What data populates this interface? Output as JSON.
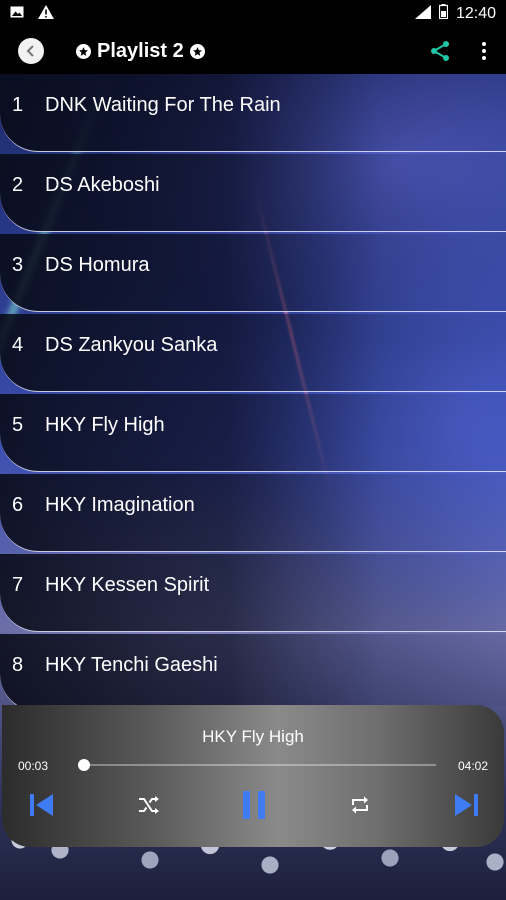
{
  "status_bar": {
    "time": "12:40",
    "icons": [
      "image-icon",
      "warning-icon",
      "wifi-icon",
      "battery-icon"
    ]
  },
  "app_bar": {
    "title": "Playlist 2",
    "icons": [
      "back-icon",
      "star-badge-icon",
      "share-icon",
      "more-vert-icon"
    ]
  },
  "tracks": [
    {
      "num": "1",
      "title": "DNK Waiting For The Rain"
    },
    {
      "num": "2",
      "title": "DS Akeboshi"
    },
    {
      "num": "3",
      "title": "DS Homura"
    },
    {
      "num": "4",
      "title": "DS Zankyou Sanka"
    },
    {
      "num": "5",
      "title": "HKY Fly High"
    },
    {
      "num": "6",
      "title": "HKY Imagination"
    },
    {
      "num": "7",
      "title": "HKY Kessen Spirit"
    },
    {
      "num": "8",
      "title": "HKY Tenchi Gaeshi"
    }
  ],
  "player": {
    "now_playing": "HKY Fly High",
    "current_time": "00:03",
    "total_time": "04:02",
    "progress_fraction": 0.012,
    "controls": [
      "skip-previous-icon",
      "shuffle-icon",
      "pause-icon",
      "repeat-icon",
      "skip-next-icon"
    ]
  },
  "colors": {
    "accent_blue": "#3f7bf2",
    "share_green": "#1fc7a7",
    "bar_background": "#000000"
  }
}
